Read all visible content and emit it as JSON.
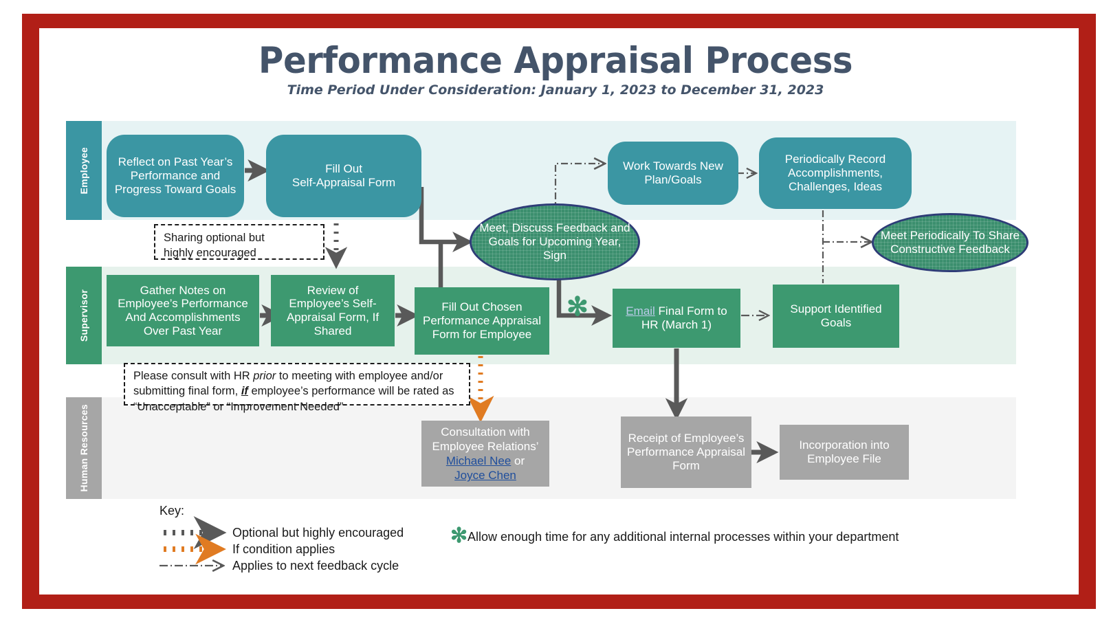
{
  "frame": {
    "border_color": "#b11f17"
  },
  "header": {
    "title": "Performance Appraisal Process",
    "subtitle": "Time Period Under Consideration: January 1, 2023 to December 31, 2023",
    "title_color": "#44546a"
  },
  "lanes": [
    {
      "id": "employee",
      "label": "Employee",
      "color": "#3b96a3",
      "band_color": "#e6f3f4"
    },
    {
      "id": "supervisor",
      "label": "Supervisor",
      "color": "#3d9970",
      "band_color": "#e6f2ec"
    },
    {
      "id": "human_resources",
      "label": "Human Resources",
      "color": "#a6a6a6",
      "band_color": "#f4f4f4"
    }
  ],
  "nodes": {
    "employee": {
      "reflect": "Reflect on Past Year’s Performance and Progress Toward Goals",
      "self_appraisal": "Fill Out\nSelf-Appraisal Form",
      "meet_discuss": "Meet, Discuss Feedback and Goals for Upcoming Year, Sign",
      "work_towards": "Work Towards New Plan/Goals",
      "periodically_record": "Periodically Record Accomplishments, Challenges, Ideas",
      "meet_periodically": "Meet Periodically To Share Constructive Feedback"
    },
    "supervisor": {
      "gather_notes": "Gather Notes on Employee’s Performance And Accomplishments Over Past Year",
      "review_self_appraisal": "Review of Employee’s Self-Appraisal Form, If Shared",
      "fill_out_chosen": "Fill Out Chosen Performance Appraisal Form for Employee",
      "email_link": "Email",
      "email_rest": " Final Form to HR (March 1)",
      "support_goals": "Support Identified Goals"
    },
    "human_resources": {
      "consultation_lead": "Consultation with Employee Relations’",
      "contact_1": "Michael Nee",
      "contact_conj": " or ",
      "contact_2": "Joyce Chen",
      "receipt": "Receipt of Employee’s Performance Appraisal Form",
      "incorporation": "Incorporation into Employee File"
    }
  },
  "notes": {
    "sharing": {
      "line1": "Sharing optional but",
      "line2": "highly encouraged"
    },
    "consult_hr": {
      "p1": "Please consult with HR ",
      "em1": "prior",
      "p2": " to meeting with employee and/or submitting final form, ",
      "em2": "if",
      "p3": " employee’s performance will be rated as “Unacceptable” or “Improvement Needed”"
    }
  },
  "key": {
    "title": "Key:",
    "items": [
      {
        "style": "dotted-gray",
        "color": "#595959",
        "label": "Optional but highly encouraged"
      },
      {
        "style": "dotted-orange",
        "color": "#e07b22",
        "label": "If condition applies"
      },
      {
        "style": "dash-dot",
        "color": "#595959",
        "label": "Applies to next feedback cycle"
      }
    ],
    "footnote": {
      "marker": "✻",
      "marker_color": "#3d9970",
      "label": "Allow enough time for any additional internal processes within your department"
    }
  },
  "icons": {
    "asterisk_note": "✻"
  }
}
